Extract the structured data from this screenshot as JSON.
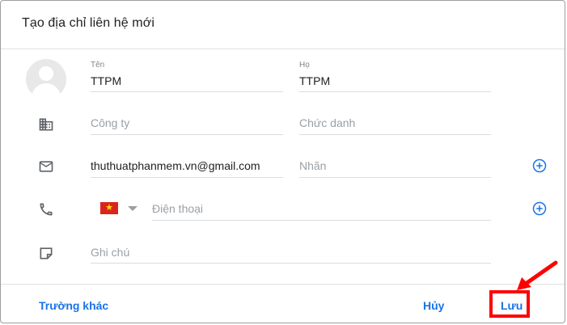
{
  "dialog": {
    "title": "Tạo địa chỉ liên hệ mới"
  },
  "name": {
    "first_label": "Tên",
    "first_value": "TTPM",
    "last_label": "Họ",
    "last_value": "TTPM"
  },
  "company": {
    "company_placeholder": "Công ty",
    "title_placeholder": "Chức danh"
  },
  "email": {
    "value": "thuthuatphanmem.vn@gmail.com",
    "label_placeholder": "Nhãn"
  },
  "phone": {
    "country_flag": "vietnam-flag",
    "placeholder": "Điện thoại"
  },
  "notes": {
    "placeholder": "Ghi chú"
  },
  "footer": {
    "more_fields_label": "Trường khác",
    "cancel_label": "Hủy",
    "save_label": "Lưu"
  },
  "colors": {
    "accent": "#1a73e8",
    "highlight": "#ff0000"
  }
}
